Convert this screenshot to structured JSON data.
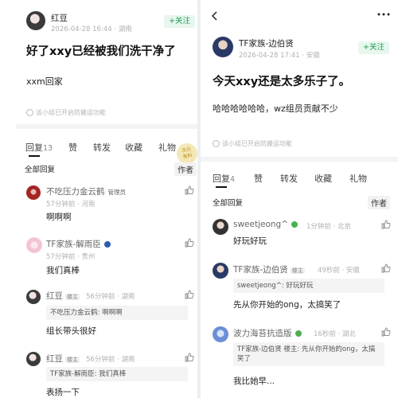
{
  "left": {
    "author": {
      "name": "红豆",
      "meta": "2026-04-28 16:44 · 湖南"
    },
    "follow_label": "+关注",
    "post_title": "好了xxy已经被我们洗干净了",
    "post_body": "xxm回家",
    "notice": "该小组已开启防搬运功能",
    "tabs": [
      {
        "label": "回复",
        "count": "13"
      },
      {
        "label": "赞",
        "count": ""
      },
      {
        "label": "转发",
        "count": ""
      },
      {
        "label": "收藏",
        "count": ""
      },
      {
        "label": "礼物",
        "count": ""
      }
    ],
    "stamp_text": "次元\n有料",
    "all_replies": "全部回复",
    "sort_label": "作者",
    "comments": [
      {
        "name": "不吃压力金云鹤",
        "tag": "管理员",
        "meta": "57分钟前 · 河南",
        "quote": "",
        "text": "啊啊啊"
      },
      {
        "name": "TF家族-解雨臣",
        "tag": "",
        "meta": "57分钟前 · 贵州",
        "quote": "",
        "text": "我们真棒"
      },
      {
        "name": "红豆",
        "tag": "楼主",
        "meta": "56分钟前 · 湖南",
        "quote": "不吃压力金云鹤: 啊啊啊",
        "text": "组长带头很好"
      },
      {
        "name": "红豆",
        "tag": "楼主",
        "meta": "56分钟前 · 湖南",
        "quote": "TF家族-解雨臣: 我们真棒",
        "text": "表扬一下"
      }
    ]
  },
  "right": {
    "author": {
      "name": "TF家族-边伯贤",
      "meta": "2026-04-28 17:41 · 安徽"
    },
    "follow_label": "+关注",
    "post_title": "今天xxy还是太多乐子了。",
    "post_body": "哈哈哈哈哈哈，wz组员贡献不少",
    "notice": "该小组已开启防搬运功能",
    "tabs": [
      {
        "label": "回复",
        "count": "4"
      },
      {
        "label": "赞",
        "count": ""
      },
      {
        "label": "转发",
        "count": ""
      },
      {
        "label": "收藏",
        "count": ""
      },
      {
        "label": "礼物",
        "count": ""
      }
    ],
    "all_replies": "全部回复",
    "sort_label": "作者",
    "comments": [
      {
        "name": "sweetjeong^",
        "tag": "",
        "meta": "1分钟前 · 北京",
        "quote": "",
        "text": "好玩好玩"
      },
      {
        "name": "TF家族-边伯贤",
        "tag": "楼主",
        "meta": "49秒前 · 安徽",
        "quote": "sweetjeong^: 好玩好玩",
        "text": "先从你开始的ong，太搞笑了"
      },
      {
        "name": "波力海苔抗造版",
        "tag": "",
        "meta": "16秒前 · 湖北",
        "quote": "TF家族-边伯贤 楼主: 先从你开始的ong，太搞笑了",
        "text": "我比她早..."
      }
    ]
  },
  "colors": {
    "accent_green": "#1f9d55",
    "follow_bg": "#e8f7ee",
    "divider": "#f3f4f6"
  },
  "icons": [
    "back-arrow-icon",
    "more-icon",
    "like-icon",
    "notice-icon"
  ]
}
